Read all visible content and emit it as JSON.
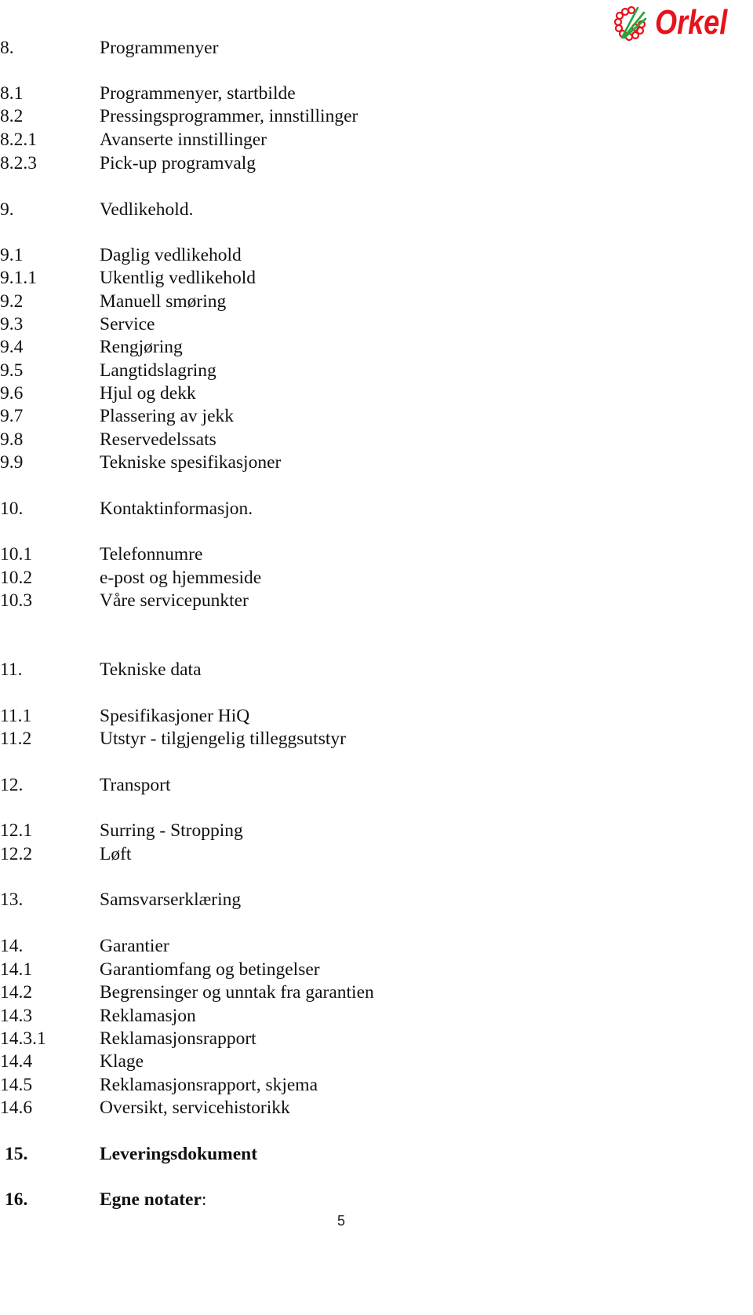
{
  "header": {
    "logo_text": "Orkel",
    "brand_color": "#e8121b",
    "logo_leaf_color": "#22a83a"
  },
  "toc": [
    {
      "num": "8.",
      "title": "Programmenyer"
    },
    {
      "num": "8.1",
      "title": "Programmenyer, startbilde"
    },
    {
      "num": "8.2",
      "title": "Pressingsprogrammer, innstillinger"
    },
    {
      "num": "8.2.1",
      "title": "Avanserte innstillinger"
    },
    {
      "num": "8.2.3",
      "title": "Pick-up programvalg"
    },
    {
      "num": "9.",
      "title": "Vedlikehold."
    },
    {
      "num": "9.1",
      "title": "Daglig vedlikehold"
    },
    {
      "num": "9.1.1",
      "title": "Ukentlig vedlikehold"
    },
    {
      "num": "9.2",
      "title": "Manuell smøring"
    },
    {
      "num": "9.3",
      "title": "Service"
    },
    {
      "num": "9.4",
      "title": "Rengjøring"
    },
    {
      "num": "9.5",
      "title": "Langtidslagring"
    },
    {
      "num": "9.6",
      "title": "Hjul og dekk"
    },
    {
      "num": "9.7",
      "title": "Plassering av jekk"
    },
    {
      "num": "9.8",
      "title": "Reservedelssats"
    },
    {
      "num": "9.9",
      "title": "Tekniske spesifikasjoner"
    },
    {
      "num": "10.",
      "title": "Kontaktinformasjon."
    },
    {
      "num": "10.1",
      "title": "Telefonnumre"
    },
    {
      "num": "10.2",
      "title": "e-post og hjemmeside"
    },
    {
      "num": "10.3",
      "title": "Våre servicepunkter"
    },
    {
      "num": "11.",
      "title": "Tekniske data"
    },
    {
      "num": "11.1",
      "title": "Spesifikasjoner HiQ"
    },
    {
      "num": "11.2",
      "title": "Utstyr - tilgjengelig tilleggsutstyr"
    },
    {
      "num": "12.",
      "title": "Transport"
    },
    {
      "num": "12.1",
      "title": "Surring - Stropping"
    },
    {
      "num": "12.2",
      "title": "Løft"
    },
    {
      "num": "13.",
      "title": "Samsvarserklæring"
    },
    {
      "num": "14.",
      "title": "Garantier"
    },
    {
      "num": "14.1",
      "title": "Garantiomfang og betingelser"
    },
    {
      "num": "14.2",
      "title": "Begrensinger og unntak fra garantien"
    },
    {
      "num": "14.3",
      "title": "Reklamasjon"
    },
    {
      "num": "14.3.1",
      "title": "Reklamasjonsrapport"
    },
    {
      "num": "14.4",
      "title": "Klage"
    },
    {
      "num": "14.5",
      "title": "Reklamasjonsrapport, skjema"
    },
    {
      "num": "14.6",
      "title": "Oversikt, servicehistorikk"
    },
    {
      "num": "15.",
      "title": "Leveringsdokument"
    },
    {
      "num": "16.",
      "title": "Egne notater",
      "suffix": ":"
    }
  ],
  "footer": {
    "page_number": "5"
  }
}
